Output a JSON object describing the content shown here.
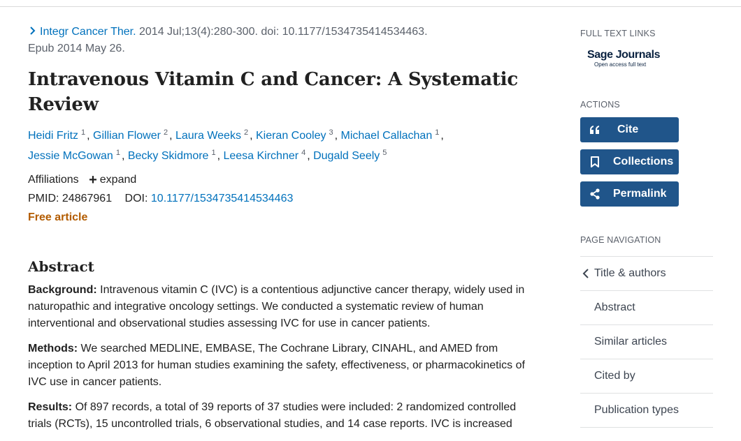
{
  "citation": {
    "journal": "Integr Cancer Ther.",
    "details_line1": " 2014 Jul;13(4):280-300. doi: 10.1177/1534735414534463.",
    "details_line2": "Epub 2014 May 26."
  },
  "title": "Intravenous Vitamin C and Cancer: A Systematic Review",
  "authors": [
    {
      "name": "Heidi Fritz",
      "aff": "1"
    },
    {
      "name": "Gillian Flower",
      "aff": "2"
    },
    {
      "name": "Laura Weeks",
      "aff": "2"
    },
    {
      "name": "Kieran Cooley",
      "aff": "3"
    },
    {
      "name": "Michael Callachan",
      "aff": "1"
    },
    {
      "name": "Jessie McGowan",
      "aff": "1"
    },
    {
      "name": "Becky Skidmore",
      "aff": "1"
    },
    {
      "name": "Leesa Kirchner",
      "aff": "4"
    },
    {
      "name": "Dugald Seely",
      "aff": "5"
    }
  ],
  "affiliations": {
    "label": "Affiliations",
    "expand_label": "expand"
  },
  "ids": {
    "pmid_label": "PMID:",
    "pmid": "24867961",
    "doi_label": "DOI:",
    "doi": "10.1177/1534735414534463"
  },
  "free_article": "Free article",
  "abstract": {
    "heading": "Abstract",
    "background_label": "Background:",
    "background_text": " Intravenous vitamin C (IVC) is a contentious adjunctive cancer therapy, widely used in naturopathic and integrative oncology settings. We conducted a systematic review of human interventional and observational studies assessing IVC for use in cancer patients.",
    "methods_label": "Methods:",
    "methods_text": " We searched MEDLINE, EMBASE, The Cochrane Library, CINAHL, and AMED from inception to April 2013 for human studies examining the safety, effectiveness, or pharmacokinetics of IVC use in cancer patients.",
    "results_label": "Results:",
    "results_text": " Of 897 records, a total of 39 reports of 37 studies were included: 2 randomized controlled trials (RCTs), 15 uncontrolled trials, 6 observational studies, and 14 case reports. IVC is increased"
  },
  "sidebar": {
    "full_text_heading": "FULL TEXT LINKS",
    "publisher_name": "Sage Journals",
    "publisher_tagline": "Open access full text",
    "actions_heading": "ACTIONS",
    "actions": [
      {
        "label": "Cite",
        "icon": "quote-icon"
      },
      {
        "label": "Collections",
        "icon": "bookmark-icon"
      },
      {
        "label": "Permalink",
        "icon": "share-icon"
      }
    ],
    "page_nav_heading": "PAGE NAVIGATION",
    "page_nav": [
      "Title & authors",
      "Abstract",
      "Similar articles",
      "Cited by",
      "Publication types"
    ]
  },
  "colors": {
    "link": "#0071bc",
    "button": "#20558a",
    "free_article": "#b35c00"
  }
}
